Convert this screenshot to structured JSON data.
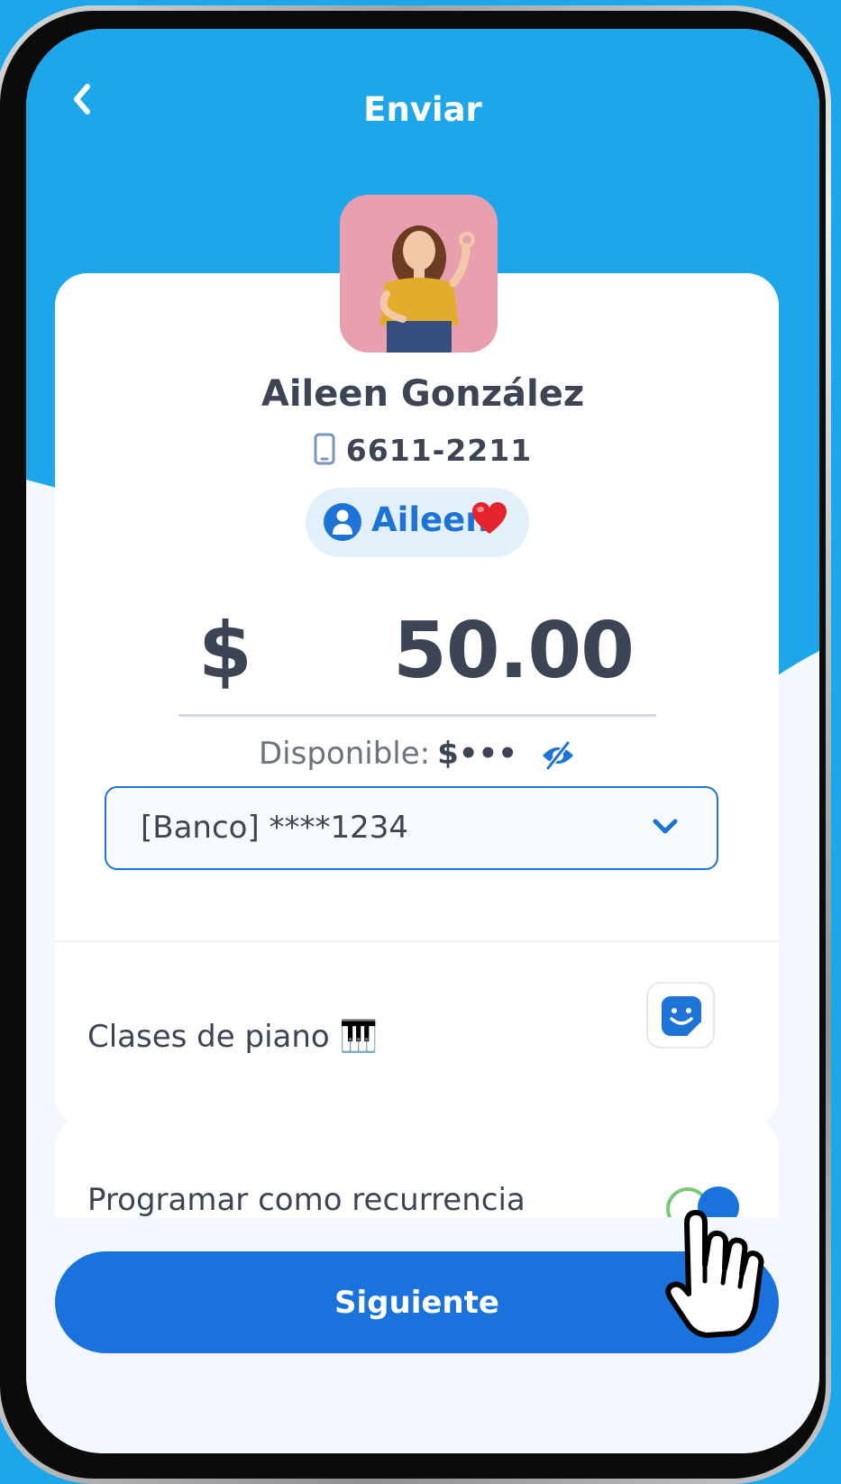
{
  "header": {
    "title": "Enviar"
  },
  "recipient": {
    "name": "Aileen González",
    "phone": "6611-2211",
    "alias": "Aileen"
  },
  "transfer": {
    "currency_symbol": "$",
    "amount": "50.00",
    "available_label": "Disponible:",
    "available_value": "$•••"
  },
  "account": {
    "selected": "[Banco] ****1234"
  },
  "concept": {
    "text": "Clases de piano 🎹"
  },
  "recurrence": {
    "label": "Programar como recurrencia",
    "enabled": true
  },
  "actions": {
    "next_label": "Siguiente"
  },
  "colors": {
    "header_blue": "#1da7ea",
    "primary": "#1a73dc",
    "text_dark": "#3d4555"
  },
  "icons": [
    "back-chevron-icon",
    "phone-icon",
    "person-icon",
    "heart-icon",
    "eye-slash-icon",
    "chevron-down-icon",
    "emoji-sticker-icon",
    "hand-cursor-icon"
  ]
}
